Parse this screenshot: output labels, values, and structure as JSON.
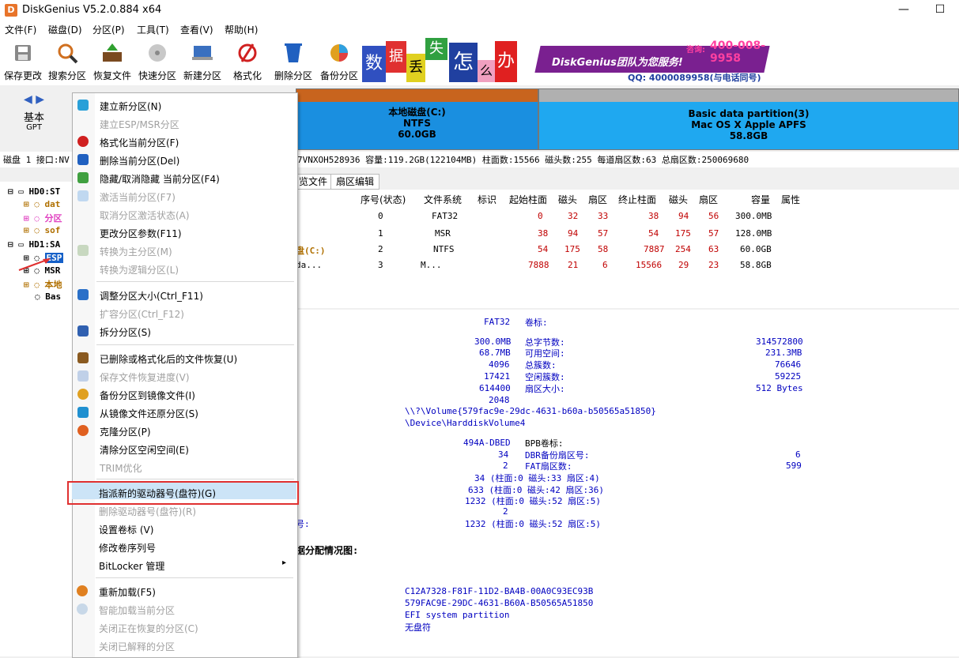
{
  "window": {
    "title": "DiskGenius V5.2.0.884 x64",
    "app_icon": "D",
    "minimize": "—",
    "maximize": "☐"
  },
  "menubar": [
    "文件(F)",
    "磁盘(D)",
    "分区(P)",
    "工具(T)",
    "查看(V)",
    "帮助(H)"
  ],
  "toolbar": [
    {
      "label": "保存更改",
      "icon": "save-icon",
      "color": "#6a6a6a"
    },
    {
      "label": "搜索分区",
      "icon": "search-icon",
      "color": "#d07020"
    },
    {
      "label": "恢复文件",
      "icon": "recover-icon",
      "color": "#7a4a20"
    },
    {
      "label": "快速分区",
      "icon": "disk-icon",
      "color": "#b0b0b0"
    },
    {
      "label": "新建分区",
      "icon": "new-partition-icon",
      "color": "#3a70c0"
    },
    {
      "label": "格式化",
      "icon": "format-icon",
      "color": "#d02020"
    },
    {
      "label": "删除分区",
      "icon": "delete-icon",
      "color": "#2060c0"
    },
    {
      "label": "备份分区",
      "icon": "backup-icon",
      "color": "#e0a020"
    }
  ],
  "banner": {
    "chars": [
      "数",
      "据",
      "丢",
      "失",
      "怎",
      "么",
      "办"
    ],
    "team": "DiskGenius团队为您服务!",
    "phone_label": "咨询:",
    "phone": "400-008-9958",
    "qq": "QQ: 4000089958(与电话同号)"
  },
  "disk_area": {
    "basic": "基本",
    "gpt": "GPT",
    "part_c": {
      "name": "本地磁盘(C:)",
      "fs": "NTFS",
      "size": "60.0GB"
    },
    "part_apfs": {
      "name": "Basic data partition(3)",
      "fs": "Mac OS X Apple APFS",
      "size": "58.8GB"
    }
  },
  "disk_info": {
    "prefix": "磁盘 1 接口:NV",
    "rest": "7VNXOH528936  容量:119.2GB(122104MB)  柱面数:15566  磁头数:255  每道扇区数:63  总扇区数:250069680"
  },
  "tree": [
    {
      "label": "HD0:ST",
      "color": "#000"
    },
    {
      "label": "dat",
      "color": "#b07000"
    },
    {
      "label": "分区",
      "color": "#e040c0"
    },
    {
      "label": "sof",
      "color": "#b07000"
    },
    {
      "label": "HD1:SA",
      "color": "#000"
    },
    {
      "label": "ESP",
      "color": "#ffffff"
    },
    {
      "label": "MSR",
      "color": "#000"
    },
    {
      "label": "本地",
      "color": "#b07000"
    },
    {
      "label": "Bas",
      "color": "#000"
    }
  ],
  "tabs": [
    "览文件",
    "扇区编辑"
  ],
  "table": {
    "headers": [
      "序号(状态)",
      "文件系统",
      "标识",
      "起始柱面",
      "磁头",
      "扇区",
      "终止柱面",
      "磁头",
      "扇区",
      "容量",
      "属性"
    ],
    "rows": [
      {
        "name": "",
        "idx": "0",
        "fs": "FAT32",
        "sc": "0",
        "sh": "32",
        "ss": "33",
        "ec": "38",
        "eh": "94",
        "es": "56",
        "cap": "300.0MB"
      },
      {
        "name": "",
        "idx": "1",
        "fs": "MSR",
        "sc": "38",
        "sh": "94",
        "ss": "57",
        "ec": "54",
        "eh": "175",
        "es": "57",
        "cap": "128.0MB"
      },
      {
        "name": "盘(C:)",
        "idx": "2",
        "fs": "NTFS",
        "sc": "54",
        "sh": "175",
        "ss": "58",
        "ec": "7887",
        "eh": "254",
        "es": "63",
        "cap": "60.0GB"
      },
      {
        "name": "da...",
        "idx": "3",
        "fs": "M...",
        "sc": "7888",
        "sh": "21",
        "ss": "6",
        "ec": "15566",
        "eh": "29",
        "es": "23",
        "cap": "58.8GB"
      }
    ]
  },
  "details": {
    "fs_value": "FAT32",
    "vol_label": "卷标:",
    "left_values": [
      "300.0MB",
      "68.7MB",
      "4096",
      "17421",
      "614400",
      "2048"
    ],
    "mid_labels": [
      "总字节数:",
      "可用空间:",
      "总簇数:",
      "空闲簇数:",
      "扇区大小:"
    ],
    "right_values": [
      "314572800",
      "231.3MB",
      "76646",
      "59225",
      "512 Bytes"
    ],
    "volume_path": "\\\\?\\Volume{579fac9e-29dc-4631-b60a-b50565a51850}",
    "device_path": "\\Device\\HarddiskVolume4",
    "bpb_left": [
      "494A-DBED",
      "34",
      "2"
    ],
    "bpb_labels": [
      "BPB卷标:",
      "DBR备份扇区号:",
      "FAT扇区数:"
    ],
    "bpb_right": [
      "6",
      "599"
    ],
    "chs_lines": [
      "34 (柱面:0 磁头:33 扇区:4)",
      "633 (柱面:0 磁头:42 扇区:36)",
      "1232 (柱面:0 磁头:52 扇区:5)",
      "2",
      "1232 (柱面:0 磁头:52 扇区:5)"
    ],
    "chs_tail_label": "号:",
    "alloc_title": "据分配情况图:",
    "guid_lines": [
      "C12A7328-F81F-11D2-BA4B-00A0C93EC93B",
      "579FAC9E-29DC-4631-B60A-B50565A51850",
      "EFI system partition",
      "无盘符"
    ]
  },
  "context_menu": [
    {
      "label": "建立新分区(N)",
      "disabled": false,
      "icon": "new-partition-icon",
      "color": "#2aa0d8"
    },
    {
      "label": "建立ESP/MSR分区",
      "disabled": true,
      "icon": "",
      "color": ""
    },
    {
      "label": "格式化当前分区(F)",
      "disabled": false,
      "icon": "format-icon",
      "color": "#d02020"
    },
    {
      "label": "删除当前分区(Del)",
      "disabled": false,
      "icon": "delete-icon",
      "color": "#2060c0"
    },
    {
      "label": "隐藏/取消隐藏 当前分区(F4)",
      "disabled": false,
      "icon": "hide-icon",
      "color": "#40a040"
    },
    {
      "label": "激活当前分区(F7)",
      "disabled": true,
      "icon": "activate-icon",
      "color": "#c0d8f0"
    },
    {
      "label": "取消分区激活状态(A)",
      "disabled": true,
      "icon": "",
      "color": ""
    },
    {
      "label": "更改分区参数(F11)",
      "disabled": false,
      "icon": "",
      "color": ""
    },
    {
      "label": "转换为主分区(M)",
      "disabled": true,
      "icon": "convert-icon",
      "color": "#c8d8c0"
    },
    {
      "label": "转换为逻辑分区(L)",
      "disabled": true,
      "icon": "",
      "color": ""
    },
    {
      "label": "调整分区大小(Ctrl_F11)",
      "disabled": false,
      "icon": "resize-icon",
      "color": "#2a70c8"
    },
    {
      "label": "扩容分区(Ctrl_F12)",
      "disabled": true,
      "icon": "",
      "color": ""
    },
    {
      "label": "拆分分区(S)",
      "disabled": false,
      "icon": "split-icon",
      "color": "#3060b0"
    },
    {
      "label": "已删除或格式化后的文件恢复(U)",
      "disabled": false,
      "icon": "recover-icon",
      "color": "#8a5a20"
    },
    {
      "label": "保存文件恢复进度(V)",
      "disabled": true,
      "icon": "save-progress-icon",
      "color": "#c0d0e8"
    },
    {
      "label": "备份分区到镜像文件(I)",
      "disabled": false,
      "icon": "backup-icon",
      "color": "#e0a020"
    },
    {
      "label": "从镜像文件还原分区(S)",
      "disabled": false,
      "icon": "restore-icon",
      "color": "#2090d0"
    },
    {
      "label": "克隆分区(P)",
      "disabled": false,
      "icon": "clone-icon",
      "color": "#e06020"
    },
    {
      "label": "清除分区空闲空间(E)",
      "disabled": false,
      "icon": "",
      "color": ""
    },
    {
      "label": "TRIM优化",
      "disabled": true,
      "icon": "",
      "color": ""
    },
    {
      "label": "指派新的驱动器号(盘符)(G)",
      "disabled": false,
      "icon": "",
      "color": "",
      "highlight": true
    },
    {
      "label": "删除驱动器号(盘符)(R)",
      "disabled": true,
      "icon": "",
      "color": ""
    },
    {
      "label": "设置卷标 (V)",
      "disabled": false,
      "icon": "",
      "color": ""
    },
    {
      "label": "修改卷序列号",
      "disabled": false,
      "icon": "",
      "color": ""
    },
    {
      "label": "BitLocker 管理",
      "disabled": false,
      "icon": "",
      "color": "",
      "submenu": "▸"
    },
    {
      "label": "重新加载(F5)",
      "disabled": false,
      "icon": "reload-icon",
      "color": "#e08020"
    },
    {
      "label": "智能加载当前分区",
      "disabled": true,
      "icon": "smart-load-icon",
      "color": "#c8d8e8"
    },
    {
      "label": "关闭正在恢复的分区(C)",
      "disabled": true,
      "icon": "",
      "color": ""
    },
    {
      "label": "关闭已解释的分区",
      "disabled": true,
      "icon": "",
      "color": ""
    }
  ],
  "colors": {
    "highlight": "#cce4f7",
    "annotation_box": "#e03030",
    "table_red": "#c00000",
    "table_blue": "#0000c0"
  }
}
